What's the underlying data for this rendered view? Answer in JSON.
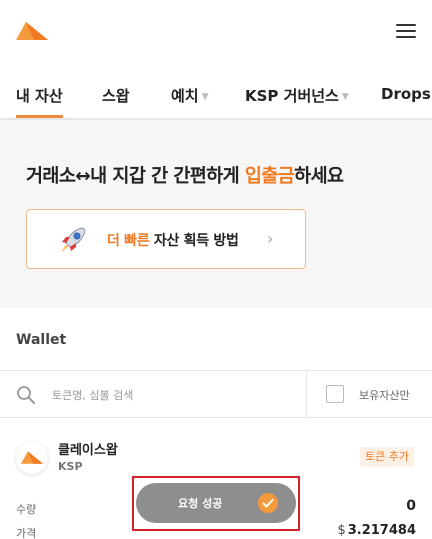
{
  "header": {
    "logo_icon": "exchange-logo",
    "menu_icon": "hamburger-menu-icon"
  },
  "tabs": [
    {
      "label": "내 자산",
      "active": true,
      "has_dropdown": false
    },
    {
      "label": "스왑",
      "active": false,
      "has_dropdown": false
    },
    {
      "label": "예치",
      "active": false,
      "has_dropdown": true
    },
    {
      "label": "KSP 거버넌스",
      "active": false,
      "has_dropdown": true
    },
    {
      "label": "Drops",
      "active": false,
      "has_dropdown": false
    }
  ],
  "banner": {
    "title_prefix": "거래소↔내 지갑 간 간편하게 ",
    "title_highlight": "입출금",
    "title_suffix": "하세요",
    "promo_highlight": "더 빠른",
    "promo_text": " 자산 획득 방법",
    "promo_icon": "rocket-icon"
  },
  "wallet": {
    "title": "Wallet",
    "search_placeholder": "토큰명, 심볼 검색",
    "owned_only_label": "보유자산만",
    "owned_only_checked": false
  },
  "token": {
    "name": "클레이스왑",
    "symbol": "KSP",
    "add_label": "토큰 추가",
    "quantity_label": "수량",
    "quantity_value": "0",
    "price_label": "가격",
    "price_currency": "$",
    "price_value": "3.217484"
  },
  "toast": {
    "text": "요청 성공",
    "icon": "check-icon"
  },
  "colors": {
    "accent": "#f07a22",
    "toast_bg": "#8e8e8e",
    "highlight_frame": "#d0202a"
  }
}
